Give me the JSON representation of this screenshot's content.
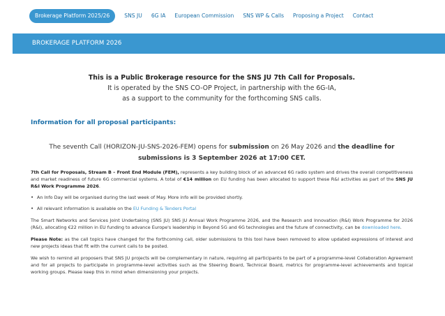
{
  "nav": {
    "items": [
      {
        "label": "Brokerage Platform 2025/26",
        "active": true
      },
      {
        "label": "SNS JU"
      },
      {
        "label": "6G IA"
      },
      {
        "label": "European Commission"
      },
      {
        "label": "SNS WP & Calls"
      },
      {
        "label": "Proposing a Project"
      },
      {
        "label": "Contact"
      }
    ]
  },
  "banner": {
    "title": "BROKERAGE PLATFORM 2026"
  },
  "intro": {
    "line1": "This is a Public Brokerage resource for the SNS JU 7th Call for Proposals.",
    "line2": "It is operated by the SNS CO-OP Project, in partnership with the 6G-IA,",
    "line3": "as a support to the community for the forthcoming SNS calls."
  },
  "section_title": "Information for all proposal participants:",
  "call": {
    "part1": "The seventh Call (HORIZON-JU-SNS-2026-FEM) opens for ",
    "bold1": "submission",
    "part2": " on 26 May 2026 and ",
    "bold2": "the deadline for submissions is 3 September 2026 at 17:00 CET."
  },
  "stream": {
    "bold": "7th Call for Proposals, Stream B – Front End Module (FEM),",
    "text1": " represents a key building block of an advanced 6G radio system and drives the overall competitiveness and market readiness of future 6G commercial systems. A total of ",
    "bold2": "€14 million",
    "text2": " on EU funding has been allocated to support these R&I activities as part of the ",
    "bold3": "SNS JU R&I Work Programme 2026",
    "text3": "."
  },
  "bullets": {
    "b1": "An Info Day will be organised during the last week of May. More info will be provided shortly.",
    "b2_text": "All relevant information is available on the ",
    "b2_link": "EU Funding & Tenders Portal"
  },
  "workprog": {
    "text": "The Smart Networks and Services Joint Undertaking (SNS JU) SNS JU Annual Work Programme 2026, and the Research and Innovation (R&I) Work Programme for 2026 (R&I), allocating €22 million in EU funding to advance Europe's leadership in Beyond 5G and 6G technologies and the future of connectivity, can be ",
    "link": "downloaded here",
    "end": "."
  },
  "note": {
    "bold": "Please Note:",
    "text": " as the call topics have changed for the forthcoming call, older submissions to this tool have been removed to allow updated expressions of interest and new projects ideas that fit with the current calls to be posted."
  },
  "remind": {
    "text": "We wish to remind all proposers that SNS JU projects will be complementary in nature, requiring all participants to be part of a programme-level Collaboration Agreement and for all projects to participate in programme-level activities such as the Steering Board, Technical Board, metrics for programme-level achievements and topical working groups. Please keep this in mind when dimensioning your projects."
  }
}
